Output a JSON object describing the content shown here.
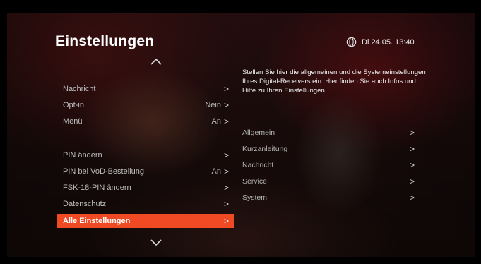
{
  "header": {
    "title": "Einstellungen",
    "datetime": "Di 24.05. 13:40"
  },
  "menu": {
    "group1": [
      {
        "label": "Nachricht",
        "value": ""
      },
      {
        "label": "Opt-in",
        "value": "Nein"
      },
      {
        "label": "Menü",
        "value": "An"
      }
    ],
    "group2": [
      {
        "label": "PIN ändern",
        "value": ""
      },
      {
        "label": "PIN bei VoD-Bestellung",
        "value": "An"
      },
      {
        "label": "FSK-18-PIN ändern",
        "value": ""
      },
      {
        "label": "Datenschutz",
        "value": ""
      },
      {
        "label": "Alle Einstellungen",
        "value": "",
        "selected": true
      }
    ],
    "chevron": ">"
  },
  "detail": {
    "description": "Stellen Sie hier die allgemeinen und die Systemeinstellungen Ihres Digital-Receivers ein. Hier finden Sie auch Infos und Hilfe zu Ihren Einstellungen.",
    "items": [
      {
        "label": "Allgemein"
      },
      {
        "label": "Kurzanleitung"
      },
      {
        "label": "Nachricht"
      },
      {
        "label": "Service"
      },
      {
        "label": "System"
      }
    ]
  },
  "icons": {
    "clock_icon": "globe-icon",
    "scroll_up": "chevron-up-icon",
    "scroll_down": "chevron-down-icon"
  },
  "colors": {
    "accent": "#ef4a24",
    "text_primary": "#ffffff",
    "text_secondary": "#bdbdbd"
  }
}
